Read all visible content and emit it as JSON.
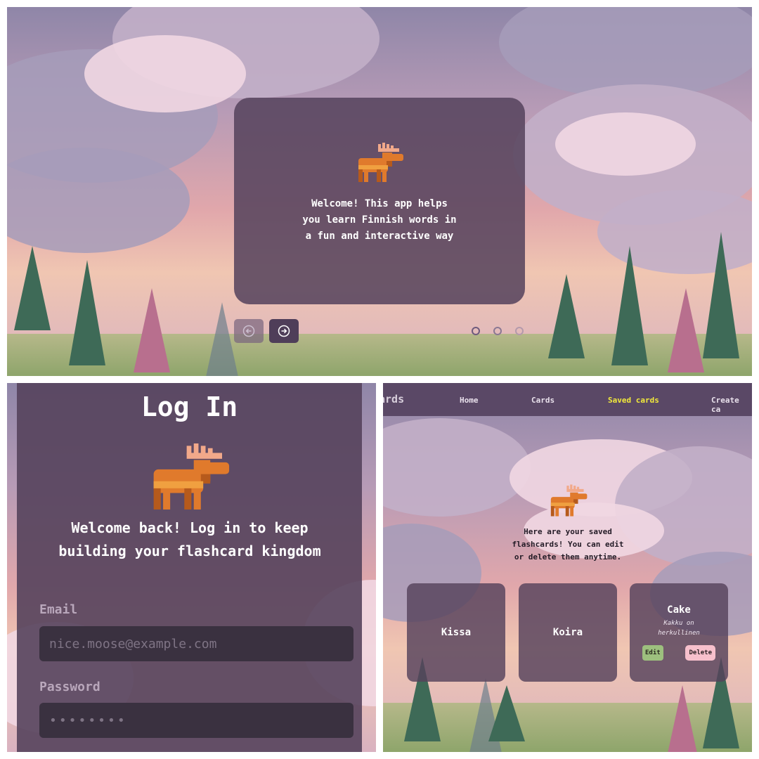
{
  "slideshow": {
    "welcome_text": "Welcome! This app helps you learn Finnish words in a fun and interactive way",
    "prev_icon": "arrow-left-circle-icon",
    "next_icon": "arrow-right-circle-icon",
    "dots_count": 3,
    "active_dot": 1
  },
  "login": {
    "title": "Log In",
    "welcome_text": "Welcome back! Log in to keep building your flashcard kingdom",
    "email_label": "Email",
    "email_placeholder": "nice.moose@example.com",
    "password_label": "Password",
    "password_placeholder": "••••••••"
  },
  "saved": {
    "navbar": {
      "brand": "ards",
      "links": [
        "Home",
        "Cards",
        "Saved cards",
        "Create ca"
      ],
      "active": "Saved cards"
    },
    "intro_text": "Here are your saved flashcards! You can edit or delete them anytime.",
    "cards": [
      {
        "word": "Kissa"
      },
      {
        "word": "Koira"
      },
      {
        "word": "Cake",
        "translation": "Kakku on herkullinen",
        "edit_label": "Edit",
        "delete_label": "Delete"
      }
    ]
  },
  "colors": {
    "card_bg": "#55425c",
    "active_nav": "#f2ea3b",
    "edit_button": "#9dc07e",
    "delete_button": "#f7c0cc"
  }
}
